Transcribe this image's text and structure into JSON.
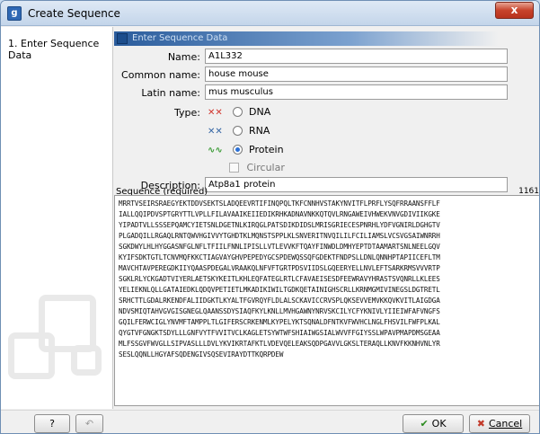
{
  "window": {
    "title": "Create Sequence",
    "close_label": "x"
  },
  "steps": [
    {
      "label": "1.  Enter Sequence Data"
    }
  ],
  "section": {
    "title": "Enter Sequence Data"
  },
  "form": {
    "name_label": "Name:",
    "name_value": "A1L332",
    "common_name_label": "Common name:",
    "common_name_value": "house mouse",
    "latin_name_label": "Latin name:",
    "latin_name_value": "mus musculus",
    "type_label": "Type:",
    "type_options": [
      {
        "label": "DNA",
        "icon": "dna-icon",
        "selected": false
      },
      {
        "label": "RNA",
        "icon": "rna-icon",
        "selected": false
      },
      {
        "label": "Protein",
        "icon": "protein-icon",
        "selected": true
      }
    ],
    "circular_label": "Circular",
    "circular_checked": false,
    "description_label": "Description:",
    "description_value": "Atp8a1 protein"
  },
  "sequence": {
    "label": "Sequence (required)",
    "length": "1161",
    "text": "MRRTVSEIRSRAEGYEKTDDVSEKTSLADQEEVRTIFINQPQLTKFCNNHVSTAKYNVITFLPRFLYSQFRRAANSFFLF\nIALLQQIPDVSPTGRYTTLVPLLFILAVAAIKEIIEDIKRHKADNAVNKKQTQVLRNGAWEIVHWEKVNVGDIVIIKGKE\nYIPADTVLLSSSEPQAMCYIETSNLDGETNLKIRQGLPATSDIKDIDSLMRISGRIECESPNRHLYDFVGNIRLDGHGTV\nPLGADQILLRGAQLRNTQWVHGIVVYTGHDTKLMQNSTSPPLKLSNVERITNVQILILFCILIAMSLVCSVGSAIWNRRH\nSGKDWYLHLHYGGASNFGLNFLTFIILFNNLIPISLLVTLEVVKFTQAYFINWDLDMHYEPTDTAAMARTSNLNEELGQV\nKYIFSDKTGTLTCNVMQFKKCTIAGVAYGHVPEPEDYGCSPDEWQSSQFGDEKTFNDPSLLDNLQNNHPTAPIICEFLTM\nMAVCHTAVPEREGDKIIYQAASPDEGALVRAAKQLNFVFTGRTPDSVIIDSLGQEERYELLNVLEFTSARKRMSVVVRTP\nSGKLRLYCKGADTVIYERLAETSKYKEITLKHLEQFATEGLRTLCFAVAEISESDFEEWRAVYHRASTSVQNRLLKLEES\nYELIEKNLQLLGATAIEDKLQDQVPETIETLMKADIKIWILTGDKQETAINIGHSCRLLKRNMGMIVINEGSLDGTRETL\nSRHCTTLGDALRKENDFALIIDGKTLKYALTFGVRQYFLDLALSCKAVICCRVSPLQKSEVVEMVKKQVKVITLAIGDGA\nNDVSMIQTAHVGVGISGNEGLQAANSSDYSIAQFKYLKNLLMVHGAWNYNRVSKCILYCFYKNIVLYIIEIWFAFVNGFS\nGQILFERWCIGLYNVMFTAMPPLTLGIFERSCRKENMLKYPELYKTSQNALDFNTKVFWVHCLNGLFHSVILFWFPLKAL\nQYGTVFGNGKTSDYLLLGNFVYTFVVITVCLKAGLETSYWTWFSHIAIWGSIALWVVFFGIYSSLWPAVPMAPDMSGEAA\nMLFSSGVFWVGLLSIPVASLLLDVLYKVIKRTAFKTLVDEVQELEAKSQDPGAVVLGKSLTERAQLLKNVFKKNHVNLYR\nSESLQQNLLHGYAFSQDENGIVSQSEVIRAYDTTKQRPDEW"
  },
  "buttons": {
    "help_label": "?",
    "help_icon": "question-icon",
    "back_icon": "back-arrow-icon",
    "ok_label": "OK",
    "ok_icon": "checkmark-icon",
    "cancel_label": "Cancel",
    "cancel_icon": "cross-icon"
  }
}
